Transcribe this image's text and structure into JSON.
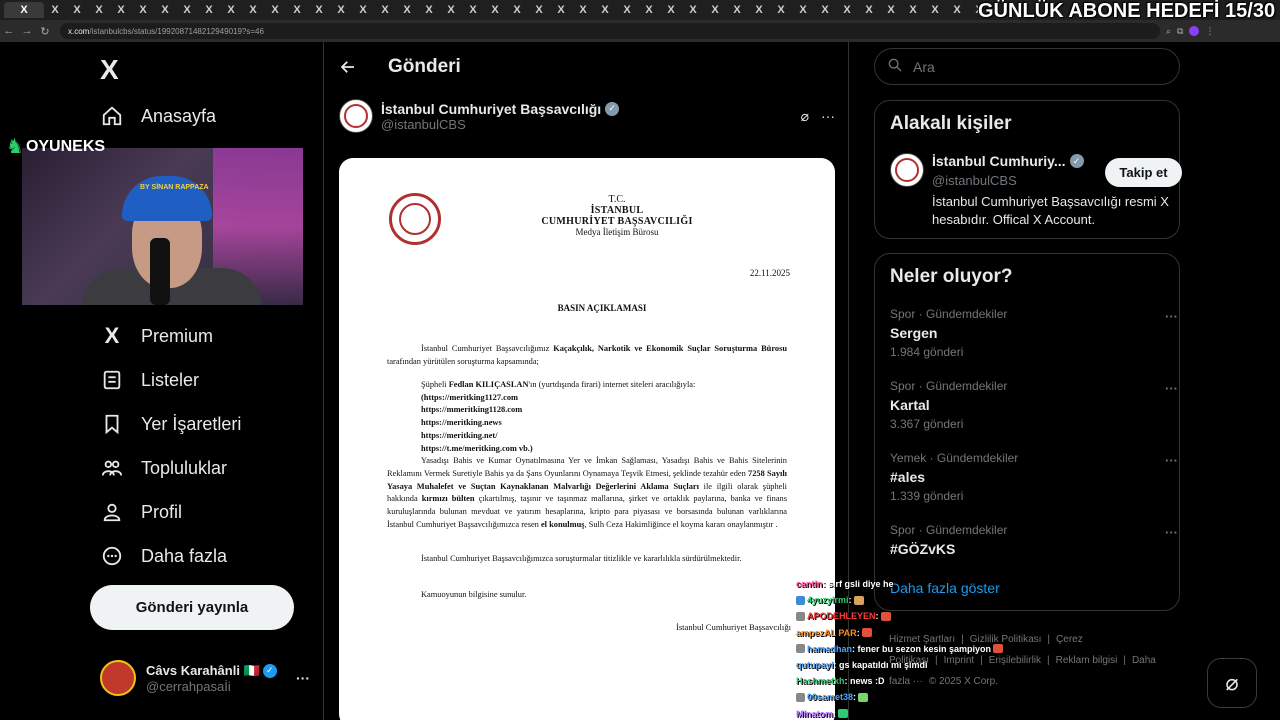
{
  "overlay": {
    "goal_text": "GÜNLÜK ABONE HEDEFİ 15/30",
    "cam_logo": "OYUNEKS",
    "cap_text": "BY SİNAN RAPPAZA"
  },
  "browser": {
    "url_host": "x.com",
    "url_path": "/istanbulcbs/status/1992087148212949019?s=46",
    "tab_glyph": "X"
  },
  "sidebar": {
    "logo": "X",
    "items": [
      {
        "label": "Anasayfa",
        "icon": "home-icon"
      },
      {
        "label": "Premium",
        "icon": "x-premium-icon"
      },
      {
        "label": "Listeler",
        "icon": "list-icon"
      },
      {
        "label": "Yer İşaretleri",
        "icon": "bookmark-icon"
      },
      {
        "label": "Topluluklar",
        "icon": "communities-icon"
      },
      {
        "label": "Profil",
        "icon": "profile-icon"
      },
      {
        "label": "Daha fazla",
        "icon": "more-circle-icon"
      }
    ],
    "post_button": "Gönderi yayınla",
    "account": {
      "name": "Câvs Karahânli 🇮🇹",
      "handle": "@cerrahpasaİi"
    }
  },
  "main": {
    "title": "Gönderi",
    "author": {
      "name": "İstanbul Cumhuriyet Başsavcılığı",
      "handle": "@istanbulCBS"
    },
    "document": {
      "header": [
        "T.C.",
        "İSTANBUL",
        "CUMHURİYET BAŞSAVCILIĞI",
        "Medya İletişim Bürosu"
      ],
      "date": "22.11.2025",
      "title": "BASIN AÇIKLAMASI",
      "p1_a": "İstanbul Cumhuriyet Başsavcılığımız ",
      "p1_b": "Kaçakçılık, Narkotik ve Ekonomik Suçlar Soruşturma Bürosu",
      "p1_c": " tarafından yürütülen soruşturma kapsamında;",
      "p2_a": "Şüpheli ",
      "p2_b": "Fedlan KILIÇASLAN",
      "p2_c": "'ın (yurtdışında firari) internet siteleri aracılığıyla:",
      "links": [
        "(https://meritking1127.com",
        "https://mmeritking1128.com",
        "https://meritking.news",
        "https://meritking.net/",
        "https://t.me/meritking.com vb.)"
      ],
      "p2_body_a": "Yasadışı Bahis ve Kumar Oynatılmasına Yer ve İmkan Sağlaması, Yasadışı Bahis ve Bahis Sitelerinin Reklamını Vermek Suretiyle Bahis ya da Şans Oyunlarını Oynamaya Teşvik Etmesi, şeklinde tezahür eden ",
      "p2_body_b": "7258 Sayılı Yasaya Muhalefet ve Suçtan Kaynaklanan Malvarlığı Değerlerini Aklama Suçları",
      "p2_body_c": " ile ilgili olarak şüpheli hakkında ",
      "p2_body_d": "kırmızı bülten",
      "p2_body_e": " çıkartılmış, taşınır ve taşınmaz mallarına, şirket ve ortaklık paylarına, banka ve finans kuruluşlarında bulunan mevduat ve yatırım hesaplarına, kripto para piyasası ve borsasında bulunan varlıklarına İstanbul Cumhuriyet Başsavcılığımızca resen ",
      "p2_body_f": "el konulmuş",
      "p2_body_g": ", Sulh Ceza Hakimliğince el koyma kararı onaylanmıştır .",
      "p3": "İstanbul Cumhuriyet Başsavcılığımızca soruşturmalar titizlikle ve kararlılıkla sürdürülmektedir.",
      "p4": "Kamuoyunun bilgisine sunulur.",
      "signature": "İstanbul Cumhuriyet Başsavcılığı"
    }
  },
  "right": {
    "search_placeholder": "Ara",
    "relevant": {
      "title": "Alakalı kişiler",
      "name": "İstanbul Cumhuriy...",
      "handle": "@istanbulCBS",
      "follow_label": "Takip et",
      "bio": "İstanbul Cumhuriyet Başsavcılığı resmi X hesabıdır. Offical X Account."
    },
    "trends": {
      "title": "Neler oluyor?",
      "items": [
        {
          "meta": "Spor · Gündemdekiler",
          "topic": "Sergen",
          "count": "1.984 gönderi"
        },
        {
          "meta": "Spor · Gündemdekiler",
          "topic": "Kartal",
          "count": "3.367 gönderi"
        },
        {
          "meta": "Yemek · Gündemdekiler",
          "topic": "#ales",
          "count": "1.339 gönderi"
        },
        {
          "meta": "Spor · Gündemdekiler",
          "topic": "#GÖZvKS",
          "count": ""
        }
      ],
      "show_more": "Daha fazla göster"
    },
    "footer": [
      "Hizmet Şartları",
      "|",
      "Gizlilik Politikası",
      "|",
      "Çerez Politikası",
      "|",
      "Imprint",
      "|",
      "Erişilebilirlik",
      "|",
      "Reklam bilgisi",
      "|",
      "Daha fazla ···",
      "© 2025 X Corp."
    ]
  },
  "chat": [
    {
      "user": "cantin",
      "color": "#ff4f9a",
      "msg": ": sırf gsli diye he",
      "badge": ""
    },
    {
      "user": "4yuzyirmi",
      "color": "#2ecc71",
      "msg": ": ",
      "badge": "#3a8bd8",
      "emote": "#d9a35c"
    },
    {
      "user": "APODEHLEYEN",
      "color": "#ff3b3b",
      "msg": ": ",
      "badge": "#888",
      "emote": "#e0503a"
    },
    {
      "user": "ampezAL PAR",
      "color": "#ff8c1a",
      "msg": ": ",
      "badge": "",
      "emote": "#e0503a"
    },
    {
      "user": "hamadhan",
      "color": "#4aa3ff",
      "msg": ": fener bu sezon kesin şampiyon",
      "badge": "#888",
      "emote": "#e0503a"
    },
    {
      "user": "qutupayi",
      "color": "#4aa3ff",
      "msg": ": gs kapatıldı mı şimdi",
      "badge": ""
    },
    {
      "user": "Hashmetkh",
      "color": "#2ecc71",
      "msg": ": news :D",
      "badge": ""
    },
    {
      "user": "00samet38",
      "color": "#4aa3ff",
      "msg": ": ",
      "badge": "#888",
      "emote": "#7bd36b"
    },
    {
      "user": "Minatom",
      "color": "#b77bff",
      "msg": ": ",
      "badge": "",
      "emote": "#2ecc71"
    }
  ]
}
